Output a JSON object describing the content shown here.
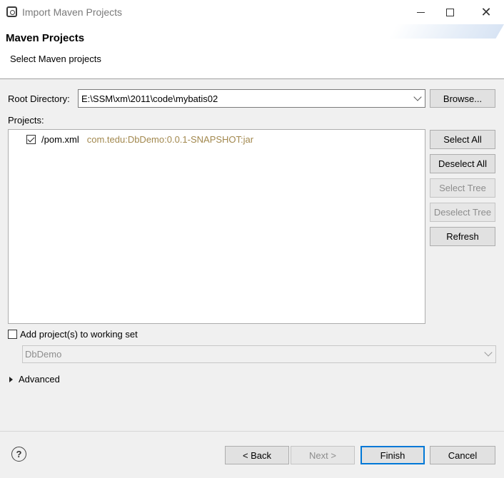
{
  "window": {
    "title": "Import Maven Projects",
    "close_glyph": "✕"
  },
  "banner": {
    "title": "Maven Projects",
    "subtitle": "Select Maven projects"
  },
  "root": {
    "label": "Root Directory:",
    "value": "E:\\SSM\\xm\\2011\\code\\mybatis02",
    "browse_label": "Browse..."
  },
  "projects": {
    "label": "Projects:",
    "items": [
      {
        "path": "/pom.xml",
        "gav": "com.tedu:DbDemo:0.0.1-SNAPSHOT:jar",
        "checked": true
      }
    ]
  },
  "side_buttons": {
    "select_all": "Select All",
    "deselect_all": "Deselect All",
    "select_tree": "Select Tree",
    "deselect_tree": "Deselect Tree",
    "refresh": "Refresh"
  },
  "working_set": {
    "label": "Add project(s) to working set",
    "checked": false,
    "value": "DbDemo"
  },
  "advanced": {
    "label": "Advanced"
  },
  "footer": {
    "help_glyph": "?",
    "back": "< Back",
    "next": "Next >",
    "finish": "Finish",
    "cancel": "Cancel"
  },
  "icons": {
    "app": "eclipse-icon",
    "help": "help-icon"
  }
}
